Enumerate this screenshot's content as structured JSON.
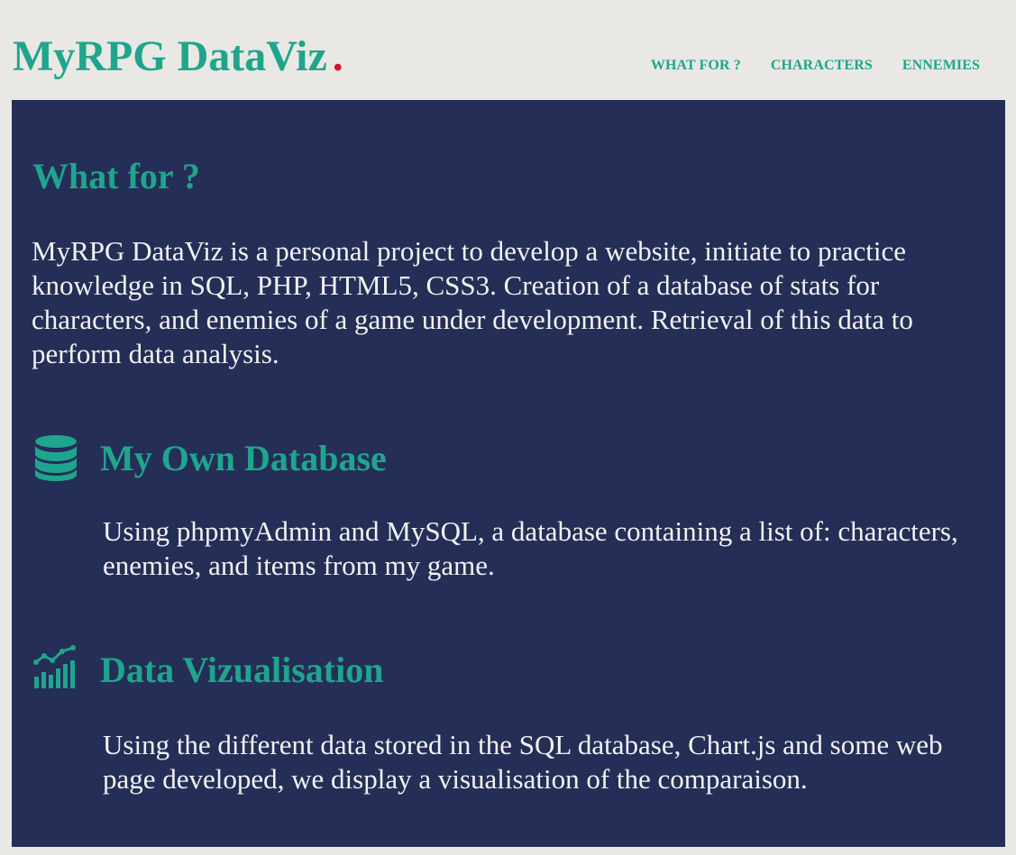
{
  "header": {
    "logo_text": "MyRPG DataViz",
    "logo_dot": "."
  },
  "nav": {
    "items": [
      {
        "label": "WHAT FOR ?"
      },
      {
        "label": "CHARACTERS"
      },
      {
        "label": "ENNEMIES"
      }
    ]
  },
  "main": {
    "section_title": "What for ?",
    "intro": "MyRPG DataViz is a personal project to develop a website, initiate to practice knowledge in SQL, PHP, HTML5, CSS3. Creation of a database of stats for characters, and enemies of a game under development. Retrieval of this data to perform data analysis.",
    "features": [
      {
        "title": "My Own Database",
        "text": "Using phpmyAdmin and MySQL, a database containing a list of: characters, enemies, and items from my game.",
        "icon": "database-icon"
      },
      {
        "title": "Data Vizualisation",
        "text": "Using the different data stored in the SQL database, Chart.js and some web page developed, we display a visualisation of the comparaison.",
        "icon": "chart-icon"
      }
    ]
  },
  "colors": {
    "accent": "#1fa58d",
    "logo_dot": "#d4132d",
    "panel_background": "#252e57",
    "page_background": "#e9e8e4",
    "body_text": "#f2f2f2"
  }
}
